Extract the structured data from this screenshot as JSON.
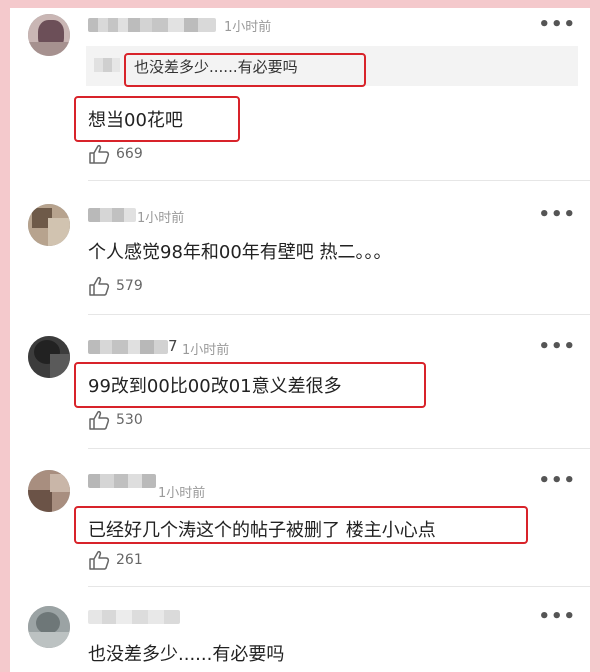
{
  "icons": {
    "more": "•••",
    "like": "thumbs-up-icon"
  },
  "colors": {
    "highlight": "#d8232a",
    "frame": "#f4c9cc"
  },
  "comments": [
    {
      "time": "1小时前",
      "quote": "也没差多少......有必要吗",
      "text": "想当00花吧",
      "likes": "669"
    },
    {
      "time": "1小时前",
      "text": "个人感觉98年和00年有壁吧  热二。。。",
      "likes": "579"
    },
    {
      "time": "1小时前",
      "name_tail": "7",
      "text": "99改到00比00改01意义差很多",
      "likes": "530"
    },
    {
      "time": "1小时前",
      "text": "已经好几个涛这个的帖子被删了 楼主小心点",
      "likes": "261"
    },
    {
      "text": "也没差多少......有必要吗"
    }
  ]
}
